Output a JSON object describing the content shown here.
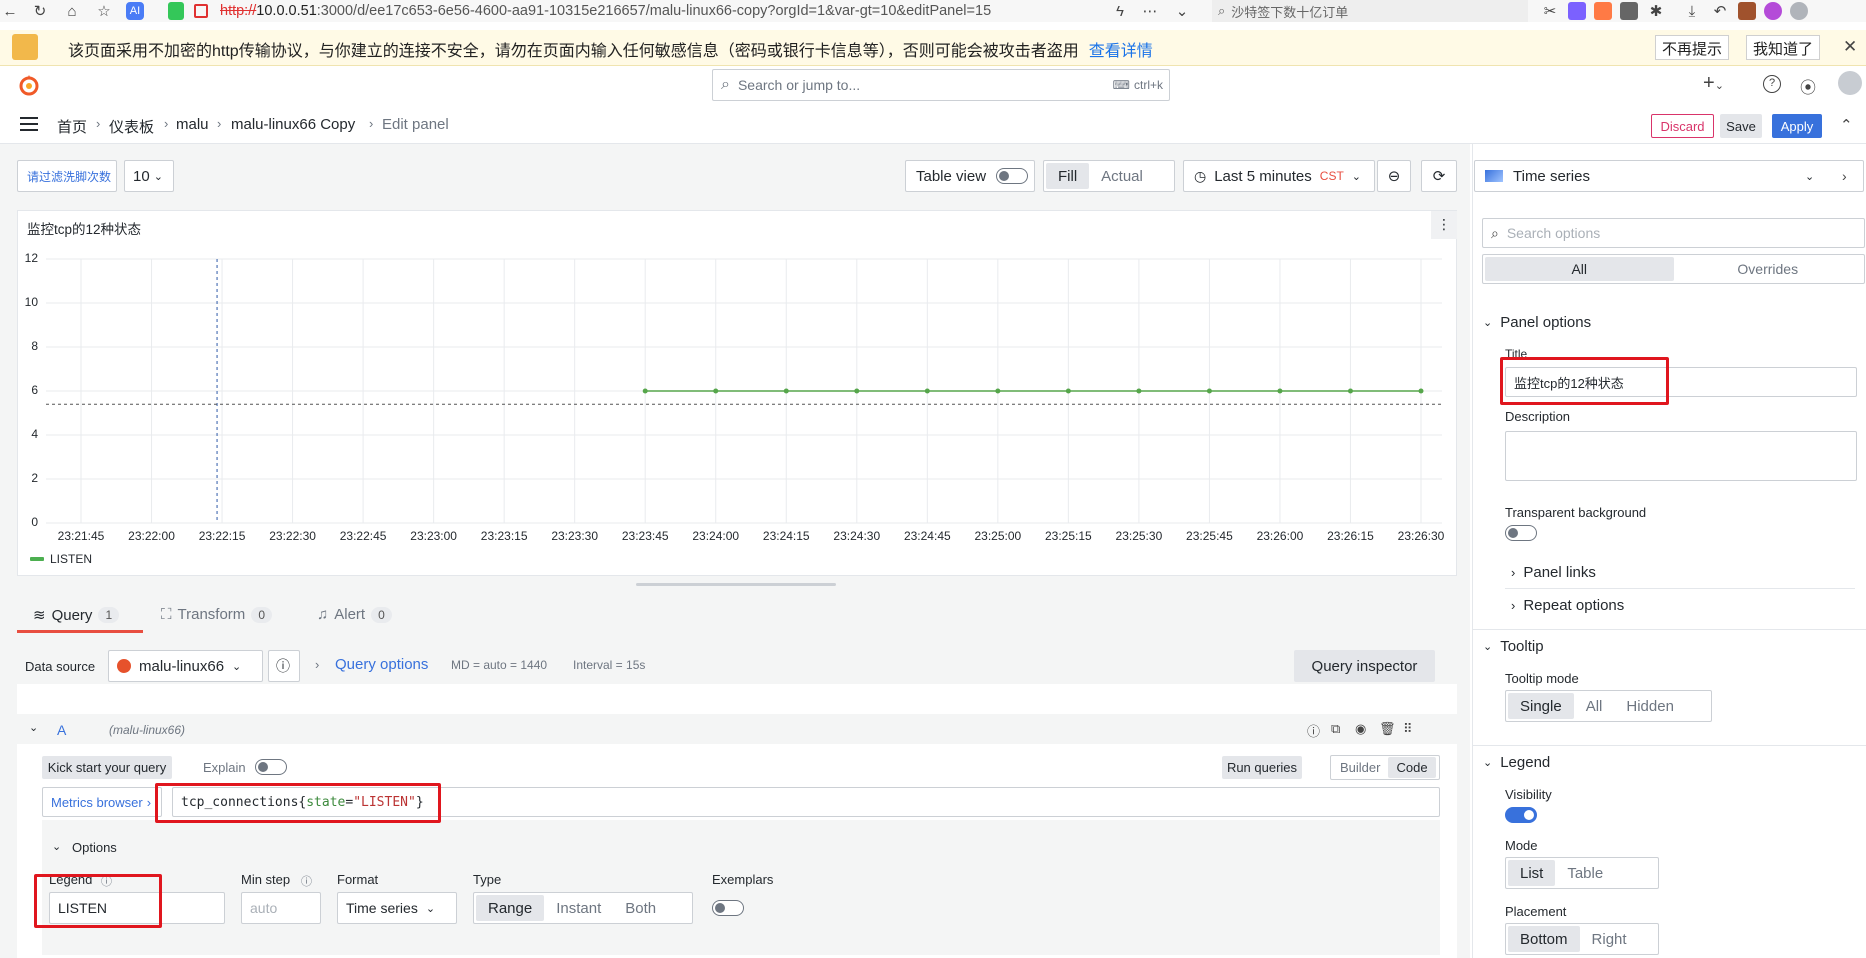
{
  "browser": {
    "url_protocol": "http://",
    "url_host": "10.0.0.51",
    "url_rest": ":3000/d/ee17c653-6e56-4600-aa91-10315e216657/malu-linux66-copy?orgId=1&var-gt=10&editPanel=15",
    "search_text": "沙特签下数十亿订单"
  },
  "warning": {
    "text": "该页面采用不加密的http传输协议，与你建立的连接不安全，请勿在页面内输入任何敏感信息（密码或银行卡信息等），否则可能会被攻击者盗用",
    "link": "查看详情",
    "btn_no_remind": "不再提示",
    "btn_got_it": "我知道了",
    "close": "✕"
  },
  "topbar": {
    "search_placeholder": "Search or jump to...",
    "shortcut": "ctrl+k",
    "plus": "+"
  },
  "breadcrumb": {
    "items": [
      "首页",
      "仪表板",
      "malu",
      "malu-linux66 Copy",
      "Edit panel"
    ],
    "sep": "›",
    "discard": "Discard",
    "save": "Save",
    "apply": "Apply"
  },
  "toolbar": {
    "var_label": "请过滤洗脚次数",
    "var_value": "10",
    "table_view": "Table view",
    "fill": "Fill",
    "actual": "Actual",
    "time_range": "Last 5 minutes",
    "timezone": "CST"
  },
  "panel": {
    "title": "监控tcp的12种状态",
    "legend": "LISTEN"
  },
  "chart_data": {
    "type": "line",
    "title": "监控tcp的12种状态",
    "x": [
      "23:21:45",
      "23:22:00",
      "23:22:15",
      "23:22:30",
      "23:22:45",
      "23:23:00",
      "23:23:15",
      "23:23:30",
      "23:23:45",
      "23:24:00",
      "23:24:15",
      "23:24:30",
      "23:24:45",
      "23:25:00",
      "23:25:15",
      "23:25:30",
      "23:25:45",
      "23:26:00",
      "23:26:15",
      "23:26:30"
    ],
    "yticks": [
      0,
      2,
      4,
      6,
      8,
      10,
      12
    ],
    "ylim": [
      0,
      12
    ],
    "series": [
      {
        "name": "LISTEN",
        "color": "#56a64b",
        "x": [
          "23:23:45",
          "23:24:00",
          "23:24:15",
          "23:24:30",
          "23:24:45",
          "23:25:00",
          "23:25:15",
          "23:25:30",
          "23:25:45",
          "23:26:00",
          "23:26:15",
          "23:26:30"
        ],
        "values": [
          6,
          6,
          6,
          6,
          6,
          6,
          6,
          6,
          6,
          6,
          6,
          6
        ]
      }
    ],
    "legend": "bottom-left",
    "grid": true
  },
  "tabs": [
    {
      "label": "Query",
      "count": "1"
    },
    {
      "label": "Transform",
      "count": "0"
    },
    {
      "label": "Alert",
      "count": "0"
    }
  ],
  "query": {
    "datasource_label": "Data source",
    "datasource": "malu-linux66",
    "query_options": "Query options",
    "md": "MD = auto = 1440",
    "interval": "Interval = 15s",
    "inspector": "Query inspector",
    "row_letter": "A",
    "row_source": "(malu-linux66)",
    "kick_start": "Kick start your query",
    "explain": "Explain",
    "run_queries": "Run queries",
    "builder": "Builder",
    "code": "Code",
    "metrics_browser": "Metrics browser",
    "expr_metric": "tcp_connections",
    "expr_label": "state",
    "expr_value": "\"LISTEN\"",
    "options": "Options",
    "legend_label": "Legend",
    "legend_value": "LISTEN",
    "min_step_label": "Min step",
    "min_step_placeholder": "auto",
    "format_label": "Format",
    "format_value": "Time series",
    "type_label": "Type",
    "type_options": [
      "Range",
      "Instant",
      "Both"
    ],
    "exemplars_label": "Exemplars"
  },
  "right": {
    "viz": "Time series",
    "search_placeholder": "Search options",
    "all": "All",
    "overrides": "Overrides",
    "panel_options": "Panel options",
    "title_label": "Title",
    "title_value": "监控tcp的12种状态",
    "description": "Description",
    "transparent": "Transparent background",
    "panel_links": "Panel links",
    "repeat_options": "Repeat options",
    "tooltip": "Tooltip",
    "tooltip_mode": "Tooltip mode",
    "tooltip_options": [
      "Single",
      "All",
      "Hidden"
    ],
    "legend": "Legend",
    "visibility": "Visibility",
    "mode": "Mode",
    "mode_options": [
      "List",
      "Table"
    ],
    "placement": "Placement",
    "placement_options": [
      "Bottom",
      "Right"
    ]
  }
}
